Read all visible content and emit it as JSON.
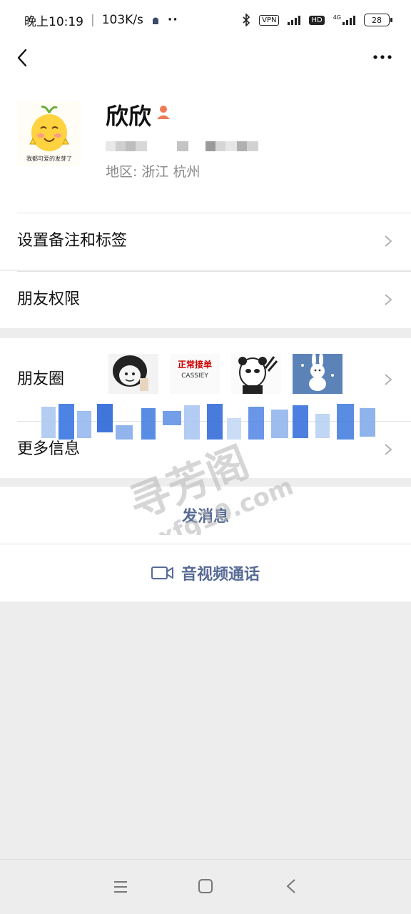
{
  "status_bar": {
    "time": "晚上10:19",
    "net_speed": "103K/s",
    "dots": "··",
    "vpn": "VPN",
    "hd": "HD",
    "network": "4G",
    "battery": "28"
  },
  "profile": {
    "name": "欣欣",
    "region": "地区:  浙江  杭州",
    "avatar_caption": "我都可爱的发芽了"
  },
  "rows": {
    "remark_tags": "设置备注和标签",
    "friend_permissions": "朋友权限",
    "moments": "朋友圈",
    "more_info": "更多信息"
  },
  "moments_thumbs": {
    "t2_title": "正常接单",
    "t2_brand": "CASSIEY"
  },
  "actions": {
    "send_message": "发消息",
    "video_call": "音视频通话"
  },
  "watermark": {
    "line1": "寻芳阁",
    "line2": "xfg10.com"
  },
  "colors": {
    "accent": "#576b95",
    "background": "#ededed"
  }
}
